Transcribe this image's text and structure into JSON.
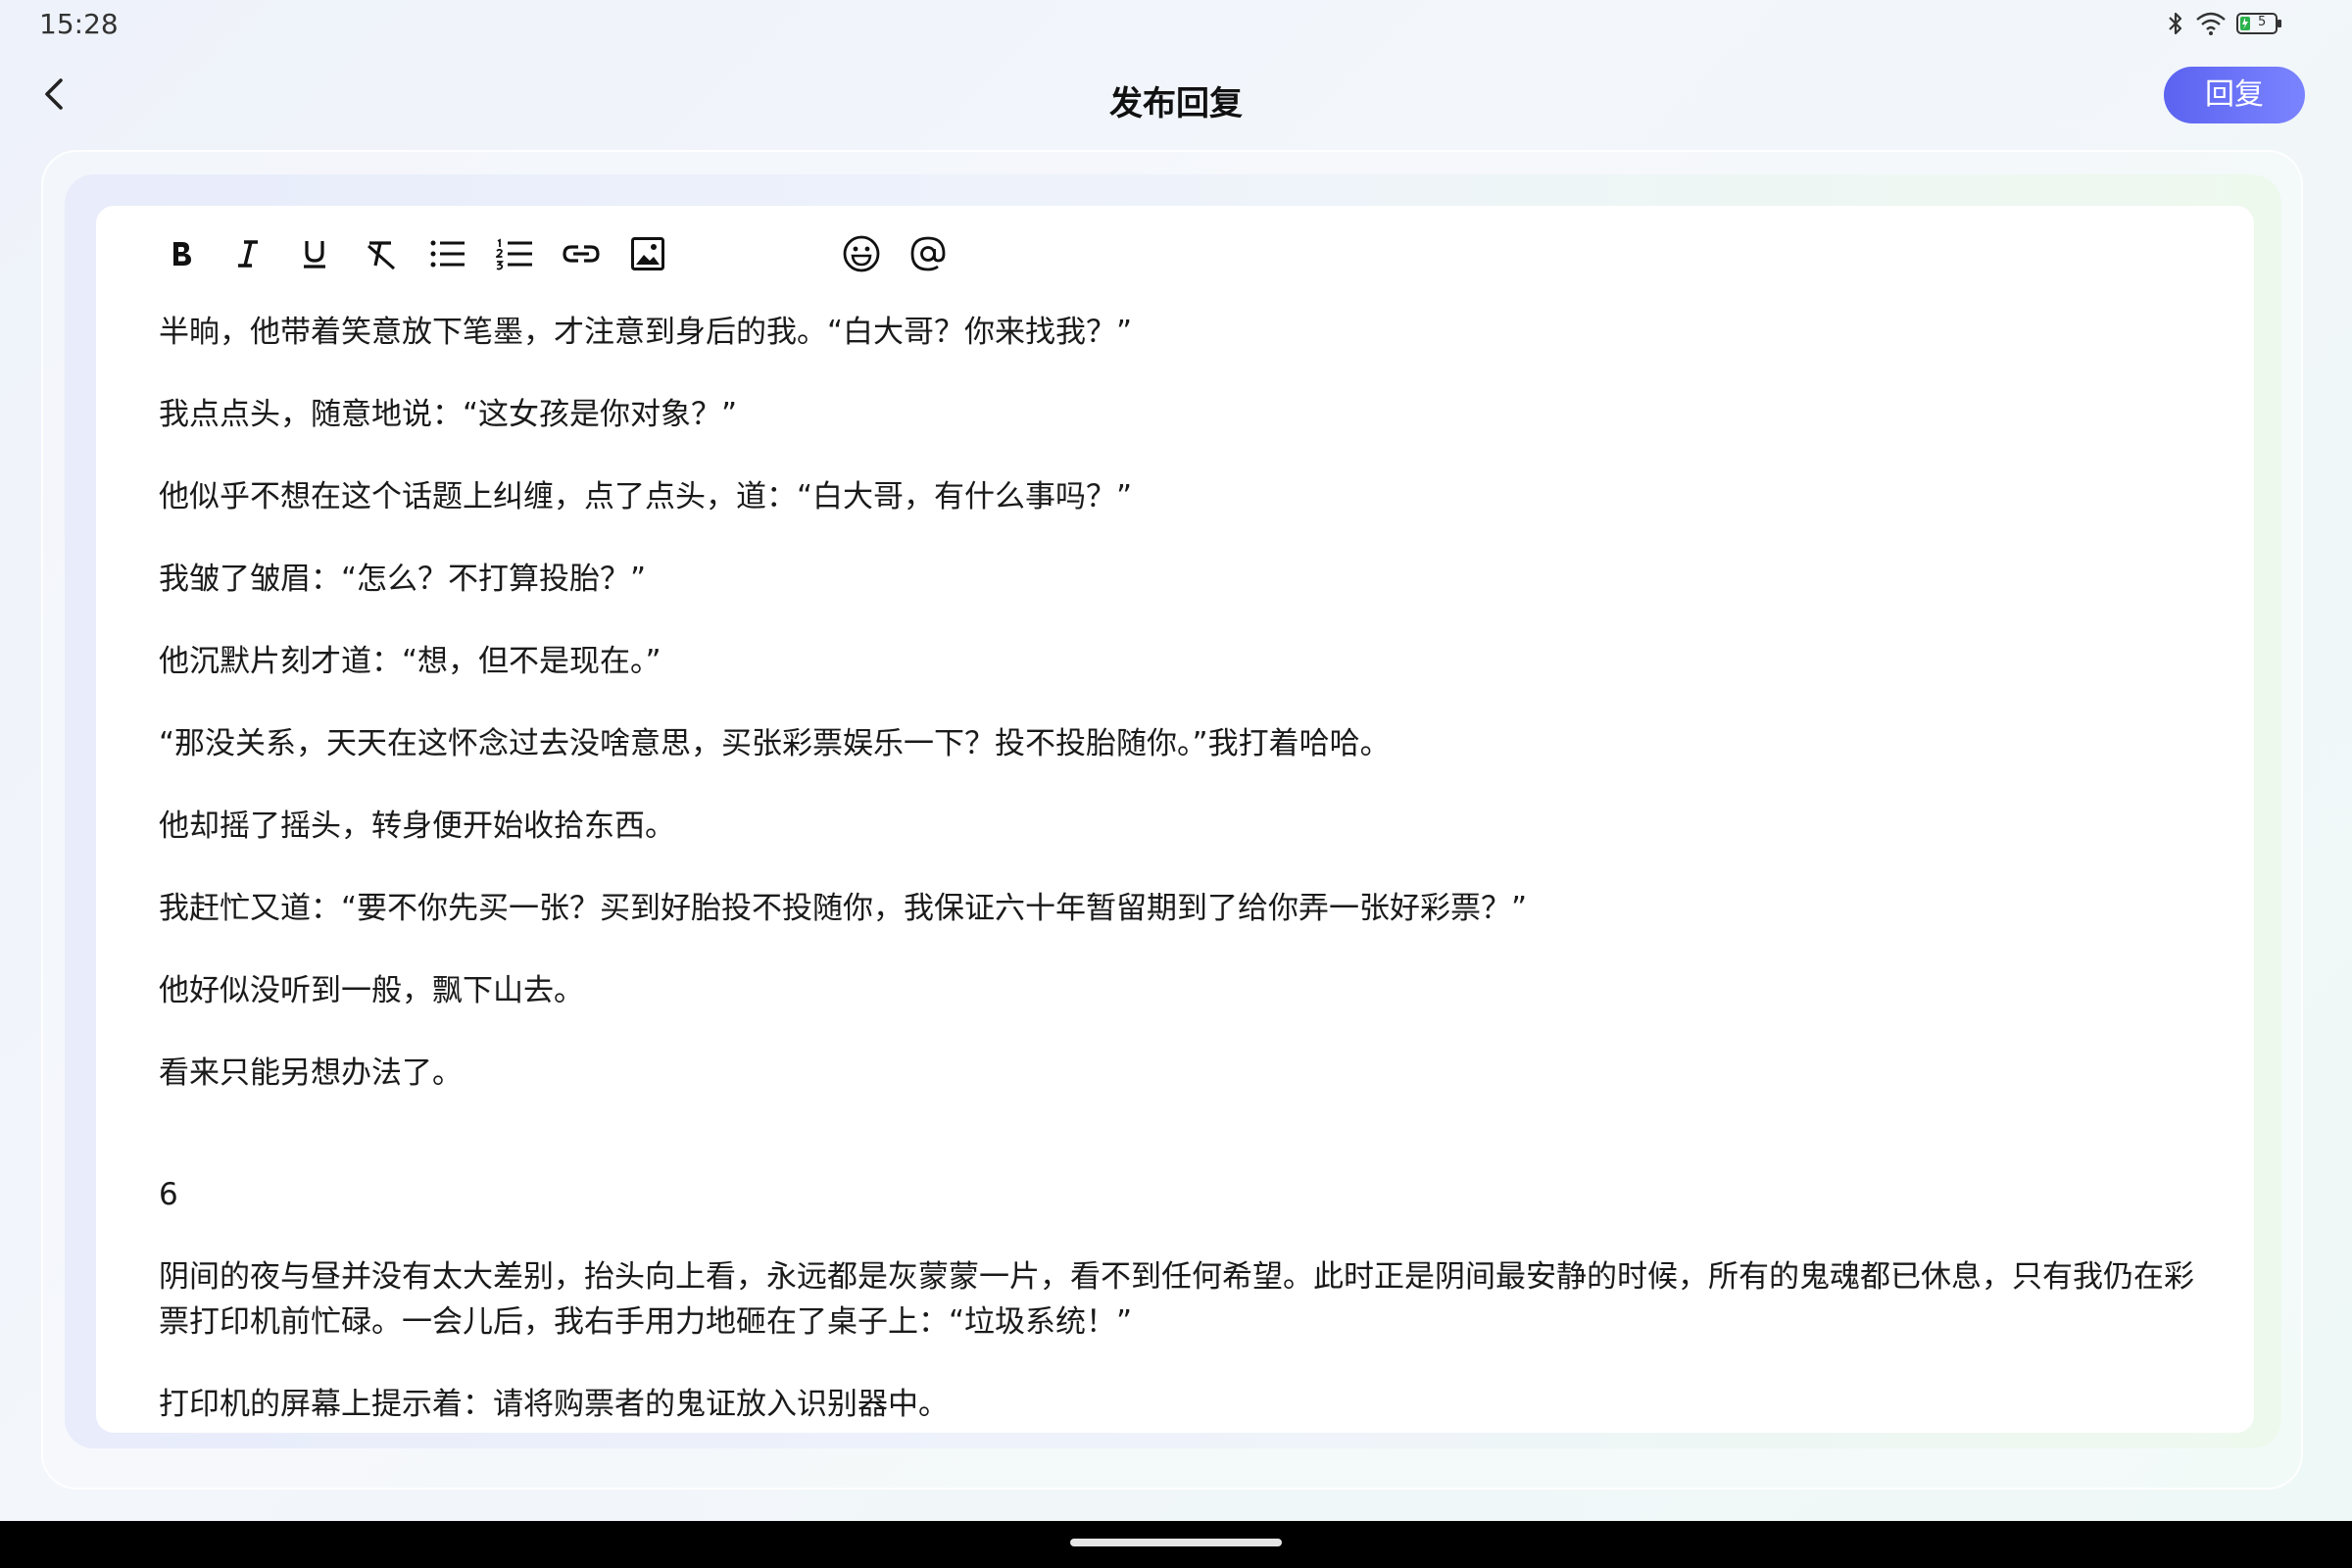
{
  "status_bar": {
    "time": "15:28",
    "icons": [
      "bluetooth-icon",
      "wifi-icon",
      "battery-icon"
    ],
    "battery_level": "5"
  },
  "header": {
    "title": "发布回复",
    "back_icon": "chevron-left-icon",
    "reply_label": "回复"
  },
  "toolbar": {
    "buttons": [
      "bold",
      "italic",
      "underline",
      "clear-format",
      "bullet-list",
      "numbered-list",
      "link",
      "image",
      "emoji",
      "mention"
    ]
  },
  "content": {
    "paragraphs": [
      "半晌，他带着笑意放下笔墨，才注意到身后的我。“白大哥？你来找我？”",
      "我点点头，随意地说：“这女孩是你对象？”",
      "他似乎不想在这个话题上纠缠，点了点头，道：“白大哥，有什么事吗？”",
      "我皱了皱眉：“怎么？不打算投胎？”",
      "他沉默片刻才道：“想，但不是现在。”",
      "“那没关系，天天在这怀念过去没啥意思，买张彩票娱乐一下？投不投胎随你。”我打着哈哈。",
      "他却摇了摇头，转身便开始收拾东西。",
      "我赶忙又道：“要不你先买一张？买到好胎投不投随你，我保证六十年暂留期到了给你弄一张好彩票？”",
      "他好似没听到一般，飘下山去。",
      "看来只能另想办法了。",
      "6",
      "阴间的夜与昼并没有太大差别，抬头向上看，永远都是灰蒙蒙一片，看不到任何希望。此时正是阴间最安静的时候，所有的鬼魂都已休息，只有我仍在彩票打印机前忙碌。一会儿后，我右手用力地砸在了桌子上：“垃圾系统！”",
      "打印机的屏幕上提示着：请将购票者的鬼证放入识别器中。"
    ]
  },
  "colors": {
    "accent_start": "#5b63f0",
    "accent_end": "#7b84ff",
    "text": "#1a1a1a",
    "nav_bar": "#000000"
  }
}
